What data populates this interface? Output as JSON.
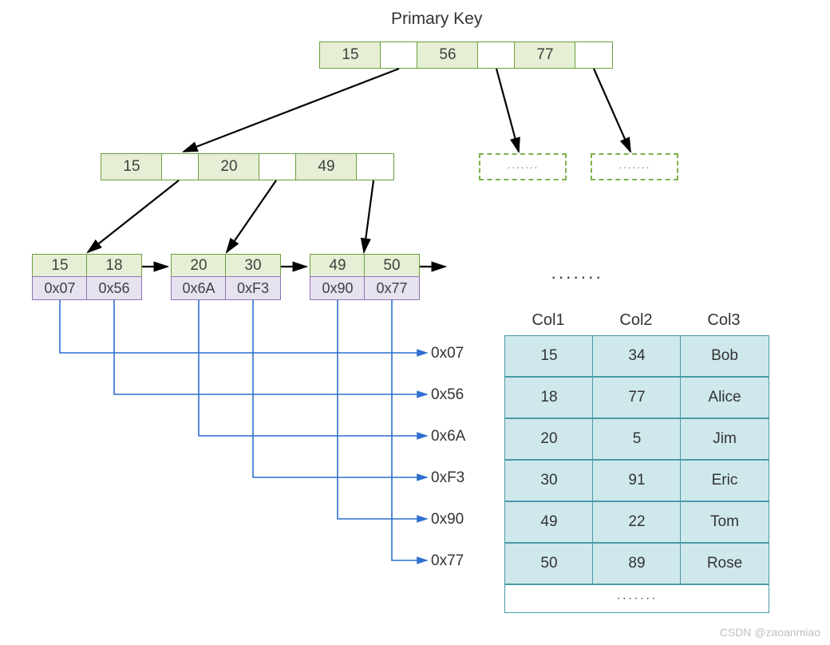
{
  "title": "Primary Key",
  "root": {
    "keys": [
      "15",
      "56",
      "77"
    ]
  },
  "mid": {
    "keys": [
      "15",
      "20",
      "49"
    ]
  },
  "ghosts": [
    "·······",
    "·······"
  ],
  "leaves": [
    {
      "keys": [
        "15",
        "18"
      ],
      "ptrs": [
        "0x07",
        "0x56"
      ]
    },
    {
      "keys": [
        "20",
        "30"
      ],
      "ptrs": [
        "0x6A",
        "0xF3"
      ]
    },
    {
      "keys": [
        "49",
        "50"
      ],
      "ptrs": [
        "0x90",
        "0x77"
      ]
    }
  ],
  "leaf_ellipsis": "·······",
  "row_labels": [
    "0x07",
    "0x56",
    "0x6A",
    "0xF3",
    "0x90",
    "0x77"
  ],
  "table": {
    "headers": [
      "Col1",
      "Col2",
      "Col3"
    ],
    "rows": [
      [
        "15",
        "34",
        "Bob"
      ],
      [
        "18",
        "77",
        "Alice"
      ],
      [
        "20",
        "5",
        "Jim"
      ],
      [
        "30",
        "91",
        "Eric"
      ],
      [
        "49",
        "22",
        "Tom"
      ],
      [
        "50",
        "89",
        "Rose"
      ]
    ],
    "footer": "·······"
  },
  "watermark": "CSDN @zaoanmiao"
}
